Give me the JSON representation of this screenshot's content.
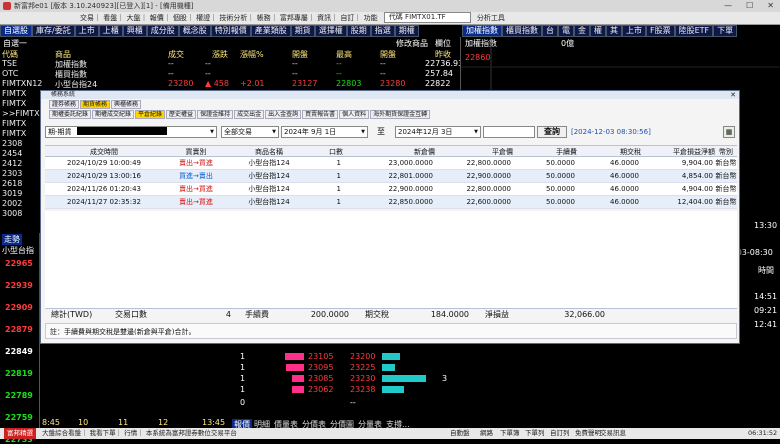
{
  "window": {
    "title": "新富邦e01 [版本 3.10.240923][已登入][1] - [備用機種]",
    "buttons": [
      "—",
      "☐",
      "✕"
    ]
  },
  "menubar": {
    "items": [
      "交易",
      "看盤",
      "大盤",
      "報價",
      "個股",
      "權證",
      "技術分析",
      "帳務",
      "富邦專屬",
      "資訊",
      "自訂",
      "功能"
    ],
    "symbol": "代碼 FIMTX01.TF",
    "extra": "分析工具"
  },
  "tabs_left": [
    {
      "label": "自選股",
      "active": true
    },
    {
      "label": "庫存/委託"
    },
    {
      "label": "上市"
    },
    {
      "label": "上櫃"
    },
    {
      "label": "興櫃"
    },
    {
      "label": "成分股"
    },
    {
      "label": "概念股"
    },
    {
      "label": "特別報價"
    },
    {
      "label": "產業類股"
    },
    {
      "label": "期貨"
    },
    {
      "label": "選擇權"
    },
    {
      "label": "股期"
    },
    {
      "label": "指選"
    },
    {
      "label": "期權"
    }
  ],
  "tabs_right": [
    {
      "label": "加權指數",
      "active": true
    },
    {
      "label": "櫃買指數"
    },
    {
      "label": "台"
    },
    {
      "label": "電"
    },
    {
      "label": "金"
    },
    {
      "label": "權"
    },
    {
      "label": "其"
    },
    {
      "label": "上市"
    },
    {
      "label": "F股票"
    },
    {
      "label": "陸股ETF"
    },
    {
      "label": "下單"
    }
  ],
  "watchlist": {
    "group_label": "自選一",
    "edit_label": "修改商品",
    "position_label": "欄位",
    "headers": [
      "代碼",
      "商品",
      "成交",
      "漲跌",
      "漲幅%",
      "開盤",
      "最高",
      "最低",
      "開盤",
      "昨收"
    ],
    "rows": [
      {
        "code": "TSE",
        "name": "加權指數",
        "last": "--",
        "chg": "--",
        "pct": "",
        "open": "--",
        "high": "--",
        "low": "--",
        "open2": "--",
        "prev": "22736.93"
      },
      {
        "code": "OTC",
        "name": "櫃買指數",
        "last": "--",
        "chg": "--",
        "pct": "",
        "open": "--",
        "high": "--",
        "low": "--",
        "open2": "--",
        "prev": "257.84"
      },
      {
        "code": "FIMTXN12",
        "name": "小型台指24",
        "last": "23280",
        "chg": "▲ 458",
        "pct": "+2.01",
        "open": "23127",
        "high": "22803",
        "low": "",
        "open2": "23280",
        "prev": "22822"
      },
      {
        "code": "FIMTX"
      },
      {
        "code": "FIMTX"
      },
      {
        "code": ">>FIMTX"
      },
      {
        "code": "FIMTX"
      },
      {
        "code": "FIMTX"
      },
      {
        "code": "2308"
      },
      {
        "code": "2454"
      },
      {
        "code": "2412"
      },
      {
        "code": "2303"
      },
      {
        "code": "2618"
      },
      {
        "code": "3019"
      },
      {
        "code": "2002"
      },
      {
        "code": "3008"
      }
    ]
  },
  "index_panel": {
    "title": "加權指數",
    "value": "0億",
    "axis": [
      "22860"
    ]
  },
  "dialog": {
    "title": "帳務系統",
    "tabs": [
      {
        "label": "證券帳務"
      },
      {
        "label": "期貨帳務",
        "active": true
      },
      {
        "label": "興櫃帳務"
      }
    ],
    "subtabs": [
      {
        "label": "期權委託紀錄"
      },
      {
        "label": "期權成交紀錄"
      },
      {
        "label": "平倉紀錄",
        "active": true
      },
      {
        "label": "歷史權益"
      },
      {
        "label": "保證金維持"
      },
      {
        "label": "成交出金"
      },
      {
        "label": "出入金查詢"
      },
      {
        "label": "買賣報告書"
      },
      {
        "label": "個人資料"
      },
      {
        "label": "海外期貨保證金互轉"
      }
    ],
    "filter": {
      "account_prefix": "期-期貨",
      "trade_type": "全部交易",
      "date_from": "2024年 9月 1日",
      "to_label": "至",
      "date_to": "2024年12月 3日",
      "query_button": "查詢",
      "timestamp": "[2024-12-03 08:30:56]"
    },
    "columns": [
      "成交時間",
      "買賣別",
      "商品名稱",
      "口數",
      "新倉價",
      "平倉價",
      "手續費",
      "期交稅",
      "平倉損益淨額",
      "幣別"
    ],
    "rows": [
      {
        "time": "2024/10/29 10:00:49",
        "side": "賣出→買進",
        "side_type": "sell_buy",
        "product": "小型台指124",
        "qty": "1",
        "open_price": "23,000.0000",
        "close_price": "22,800.0000",
        "fee": "50.0000",
        "tax": "46.0000",
        "pnl": "9,904.00",
        "currency": "新台幣"
      },
      {
        "time": "2024/10/29 13:00:16",
        "side": "買進→賣出",
        "side_type": "buy_sell",
        "product": "小型台指124",
        "qty": "1",
        "open_price": "22,801.0000",
        "close_price": "22,900.0000",
        "fee": "50.0000",
        "tax": "46.0000",
        "pnl": "4,854.00",
        "currency": "新台幣"
      },
      {
        "time": "2024/11/26 01:20:43",
        "side": "賣出→買進",
        "side_type": "sell_buy",
        "product": "小型台指124",
        "qty": "1",
        "open_price": "22,900.0000",
        "close_price": "22,800.0000",
        "fee": "50.0000",
        "tax": "46.0000",
        "pnl": "4,904.00",
        "currency": "新台幣"
      },
      {
        "time": "2024/11/27 02:35:32",
        "side": "賣出→買進",
        "side_type": "sell_buy",
        "product": "小型台指124",
        "qty": "1",
        "open_price": "22,850.0000",
        "close_price": "22,600.0000",
        "fee": "50.0000",
        "tax": "46.0000",
        "pnl": "12,404.00",
        "currency": "新台幣"
      }
    ],
    "totals": {
      "label": "總計(TWD)",
      "lots_label": "交易口數",
      "lots": "4",
      "fee_label": "手續費",
      "fee": "200.0000",
      "tax_label": "期交稅",
      "tax": "184.0000",
      "pnl_label": "淨損益",
      "pnl": "32,066.00"
    },
    "note": "註：手續費與期交稅是雙邊(新倉與平倉)合計。"
  },
  "tick_panel": {
    "tab_label": "走勢",
    "product": "小型台指",
    "price_axis": [
      "22965",
      "22939",
      "22909",
      "22879",
      "22849",
      "22819",
      "22789",
      "22759",
      "22733"
    ],
    "time_axis": [
      "8:45",
      "10",
      "11",
      "12",
      "13:45"
    ]
  },
  "depth_panel": {
    "rows": [
      {
        "bid_qty": "1",
        "bid": "23105",
        "ask": "23200"
      },
      {
        "bid_qty": "1",
        "bid": "23095",
        "ask": "23225"
      },
      {
        "bid_qty": "1",
        "bid": "23085",
        "ask": "23230",
        "ask_qty": "3"
      },
      {
        "bid_qty": "1",
        "bid": "23062",
        "ask": "23238"
      }
    ],
    "footer": [
      "0",
      "--"
    ]
  },
  "bottom_tabs": [
    "報價",
    "明細",
    "價量表",
    "分價表",
    "分價圖",
    "分量表",
    "支撐..."
  ],
  "right_bottom": {
    "time_a": "13:30",
    "date": "/03-08:30",
    "header": "時間",
    "times": [
      "14:51",
      "09:21",
      "12:41"
    ]
  },
  "statusbar": {
    "left_badge": "富邦精選",
    "items": [
      "大盤綜合看盤",
      "我看下單",
      "行情",
      "本系統為富邦證券數位交易平台"
    ],
    "right": [
      "自動盤",
      "網路",
      "下單簿",
      "下單列",
      "自訂列",
      "免費聲明",
      "交易訊息"
    ],
    "time": "06:31:52"
  },
  "colors": {
    "up": "#ff3b3b",
    "down": "#19e019",
    "accent": "#ffd400",
    "bar_pink": "#ff2f8a",
    "bar_cyan": "#22c9c9"
  }
}
